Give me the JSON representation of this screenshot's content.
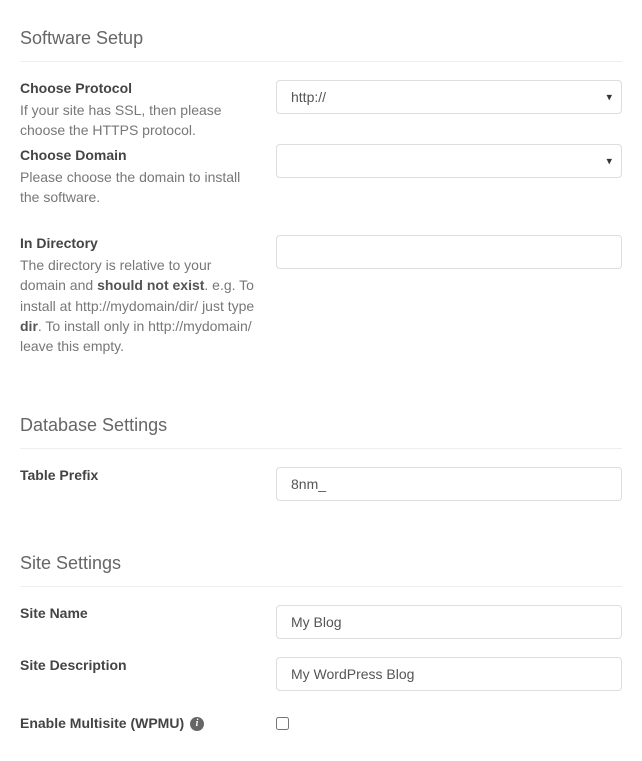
{
  "sections": {
    "software": {
      "title": "Software Setup",
      "protocol": {
        "label": "Choose Protocol",
        "help": "If your site has SSL, then please choose the HTTPS protocol.",
        "value": "http://"
      },
      "domain": {
        "label": "Choose Domain",
        "help": "Please choose the domain to install the software.",
        "value": ""
      },
      "directory": {
        "label": "In Directory",
        "help_pre": "The directory is relative to your domain and ",
        "help_bold1": "should not exist",
        "help_mid": ". e.g. To install at http://mydomain/dir/ just type ",
        "help_bold2": "dir",
        "help_post": ". To install only in http://mydomain/ leave this empty.",
        "value": ""
      }
    },
    "database": {
      "title": "Database Settings",
      "prefix": {
        "label": "Table Prefix",
        "value": "8nm_"
      }
    },
    "site": {
      "title": "Site Settings",
      "name": {
        "label": "Site Name",
        "value": "My Blog"
      },
      "description": {
        "label": "Site Description",
        "value": "My WordPress Blog"
      },
      "multisite": {
        "label": "Enable Multisite (WPMU) ",
        "checked": false
      }
    }
  }
}
